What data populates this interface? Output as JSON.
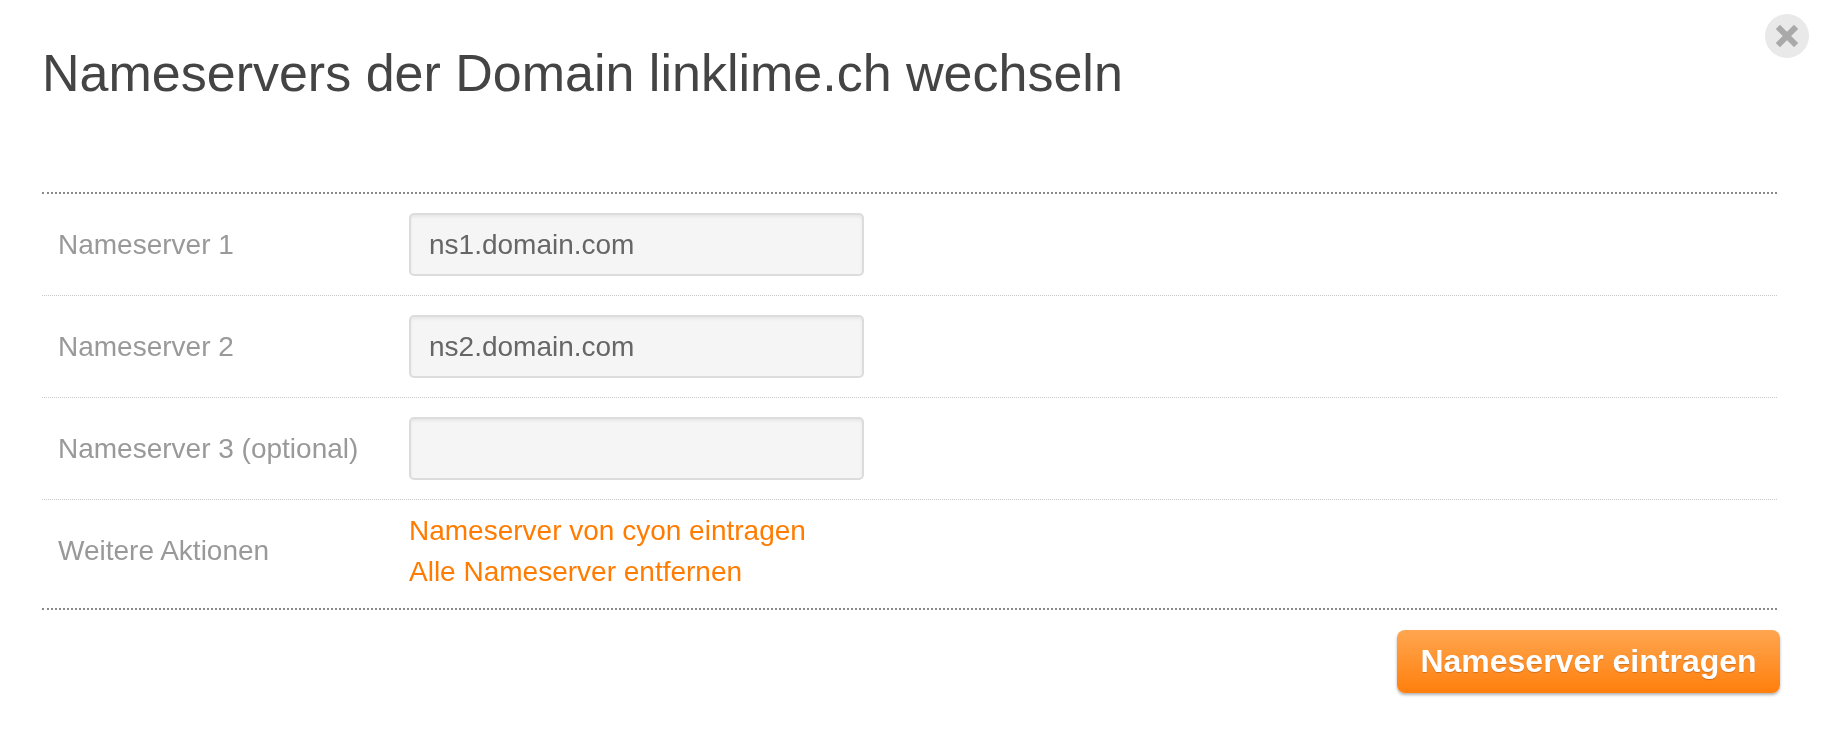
{
  "dialog": {
    "title": "Nameservers der Domain linklime.ch wechseln"
  },
  "fields": [
    {
      "label": "Nameserver 1",
      "value": "ns1.domain.com"
    },
    {
      "label": "Nameserver 2",
      "value": "ns2.domain.com"
    },
    {
      "label": "Nameserver 3 (optional)"
    }
  ],
  "actions": {
    "label": "Weitere Aktionen",
    "links": [
      "Nameserver von cyon eintragen",
      "Alle Nameserver entfernen"
    ]
  },
  "submit_button": {
    "label": "Nameserver eintragen"
  }
}
